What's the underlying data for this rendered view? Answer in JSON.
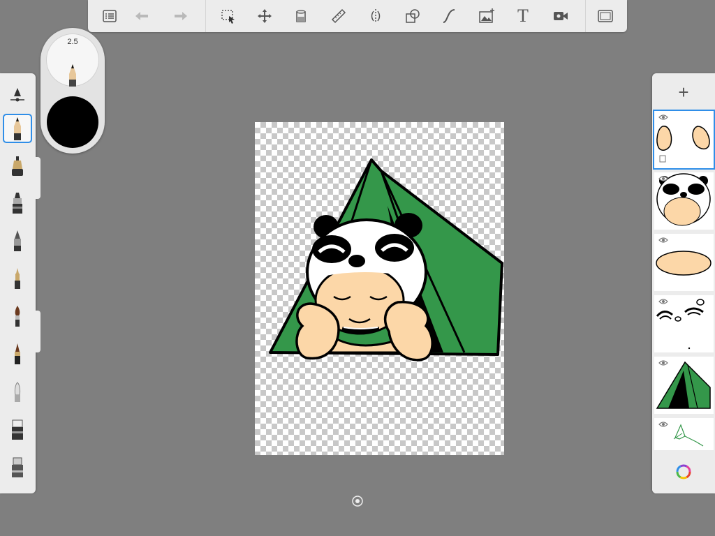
{
  "toolbar": {
    "buttons": [
      {
        "name": "lists-icon"
      },
      {
        "name": "undo-icon"
      },
      {
        "name": "redo-icon"
      },
      {
        "name": "selection-icon"
      },
      {
        "name": "transform-icon"
      },
      {
        "name": "fill-bucket-icon"
      },
      {
        "name": "ruler-icon"
      },
      {
        "name": "symmetry-icon"
      },
      {
        "name": "shapes-icon"
      },
      {
        "name": "curve-icon"
      },
      {
        "name": "add-image-icon"
      },
      {
        "name": "text-icon"
      },
      {
        "name": "video-icon"
      },
      {
        "name": "fullscreen-icon"
      }
    ],
    "text_glyph": "T"
  },
  "brush_puck": {
    "size_value": "2.5",
    "current_color": "#000000"
  },
  "brushes": [
    {
      "name": "brush-settings-icon"
    },
    {
      "name": "pencil-brush-icon",
      "selected": true
    },
    {
      "name": "airbrush-icon"
    },
    {
      "name": "marker-icon"
    },
    {
      "name": "felt-pen-icon"
    },
    {
      "name": "ballpoint-pen-icon"
    },
    {
      "name": "paintbrush-icon"
    },
    {
      "name": "ink-brush-icon"
    },
    {
      "name": "smudge-icon"
    },
    {
      "name": "eraser-icon"
    },
    {
      "name": "hard-eraser-icon"
    }
  ],
  "layers": {
    "add_label": "+",
    "items": [
      {
        "name": "layer-hands",
        "visible": true,
        "selected": true,
        "locked": true
      },
      {
        "name": "layer-panda-head",
        "visible": true
      },
      {
        "name": "layer-body-ellipse",
        "visible": true
      },
      {
        "name": "layer-eyes",
        "visible": true
      },
      {
        "name": "layer-tent",
        "visible": true
      },
      {
        "name": "layer-sketch",
        "visible": true
      }
    ]
  },
  "colors": {
    "accent": "#2f8ee8",
    "tent": "#34974a",
    "skin": "#fcd7a8",
    "background": "#7f7f7f"
  }
}
